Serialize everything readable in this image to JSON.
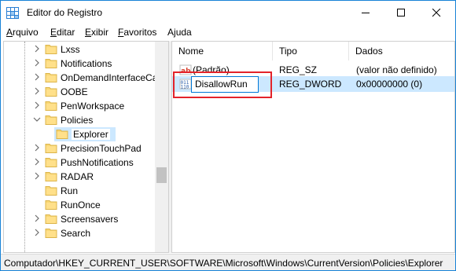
{
  "window": {
    "title": "Editor do Registro",
    "accent_color": "#1883d7",
    "selection_color": "#cce8ff",
    "highlight_color": "#e3232a"
  },
  "title_buttons": {
    "minimize_icon": "minimize-icon",
    "maximize_icon": "maximize-icon",
    "close_icon": "close-icon"
  },
  "menu": {
    "items": [
      {
        "first": "A",
        "rest": "rquivo"
      },
      {
        "first": "E",
        "rest": "ditar"
      },
      {
        "first": "E",
        "rest": "xibir",
        "prefix": ""
      },
      {
        "first": "F",
        "rest": "avoritos"
      },
      {
        "first": "Aj",
        "rest": "uda"
      }
    ]
  },
  "tree": {
    "items": [
      {
        "label": "Lxss",
        "expander": "chevron-right"
      },
      {
        "label": "Notifications",
        "expander": "chevron-right"
      },
      {
        "label": "OnDemandInterfaceCa",
        "expander": "chevron-right"
      },
      {
        "label": "OOBE",
        "expander": "chevron-right"
      },
      {
        "label": "PenWorkspace",
        "expander": "chevron-right"
      },
      {
        "label": "Policies",
        "expander": "chevron-down"
      },
      {
        "label": "Explorer",
        "expander": "none",
        "selected": true
      },
      {
        "label": "PrecisionTouchPad",
        "expander": "chevron-right"
      },
      {
        "label": "PushNotifications",
        "expander": "chevron-right"
      },
      {
        "label": "RADAR",
        "expander": "chevron-right"
      },
      {
        "label": "Run",
        "expander": "none"
      },
      {
        "label": "RunOnce",
        "expander": "none"
      },
      {
        "label": "Screensavers",
        "expander": "chevron-right"
      },
      {
        "label": "Search",
        "expander": "chevron-right"
      }
    ]
  },
  "list": {
    "columns": [
      "Nome",
      "Tipo",
      "Dados"
    ],
    "rows": [
      {
        "name": "(Padrão)",
        "type": "REG_SZ",
        "data": "(valor não definido)",
        "icon": "string-value-icon"
      },
      {
        "name": "DisallowRun",
        "type": "REG_DWORD",
        "data": "0x00000000 (0)",
        "icon": "dword-value-icon",
        "renaming": true
      }
    ]
  },
  "status": {
    "path": "Computador\\HKEY_CURRENT_USER\\SOFTWARE\\Microsoft\\Windows\\CurrentVersion\\Policies\\Explorer"
  }
}
